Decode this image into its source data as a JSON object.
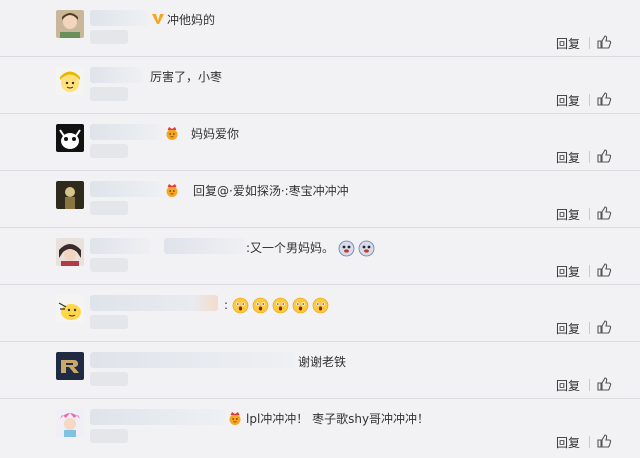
{
  "comments": [
    {
      "text": "冲他妈的",
      "badge": "yellow-v-icon",
      "reply": "回复"
    },
    {
      "text": "厉害了，小枣",
      "reply": "回复"
    },
    {
      "text": "妈妈爱你",
      "badge": "crown-face-icon",
      "reply": "回复"
    },
    {
      "text": "回复@·爱如探汤·:枣宝冲冲冲",
      "badge": "crown-face-icon",
      "reply": "回复"
    },
    {
      "text": ":又一个男妈妈。",
      "emojis": [
        "doge-icon",
        "doge-icon"
      ],
      "reply": "回复"
    },
    {
      "text": ":",
      "emojis": [
        "scared-face-icon",
        "scared-face-icon",
        "scared-face-icon",
        "scared-face-icon",
        "scared-face-icon"
      ],
      "reply": "回复"
    },
    {
      "text": "谢谢老铁",
      "reply": "回复"
    },
    {
      "text": "lpl冲冲冲！ 枣子歌shy哥冲冲冲！",
      "badge": "crown-face-icon",
      "reply": "回复"
    }
  ],
  "colors": {
    "background": "#f2f2f5",
    "divider": "#dcdce0",
    "text": "#333333",
    "badge_gold": "#f5a623"
  }
}
